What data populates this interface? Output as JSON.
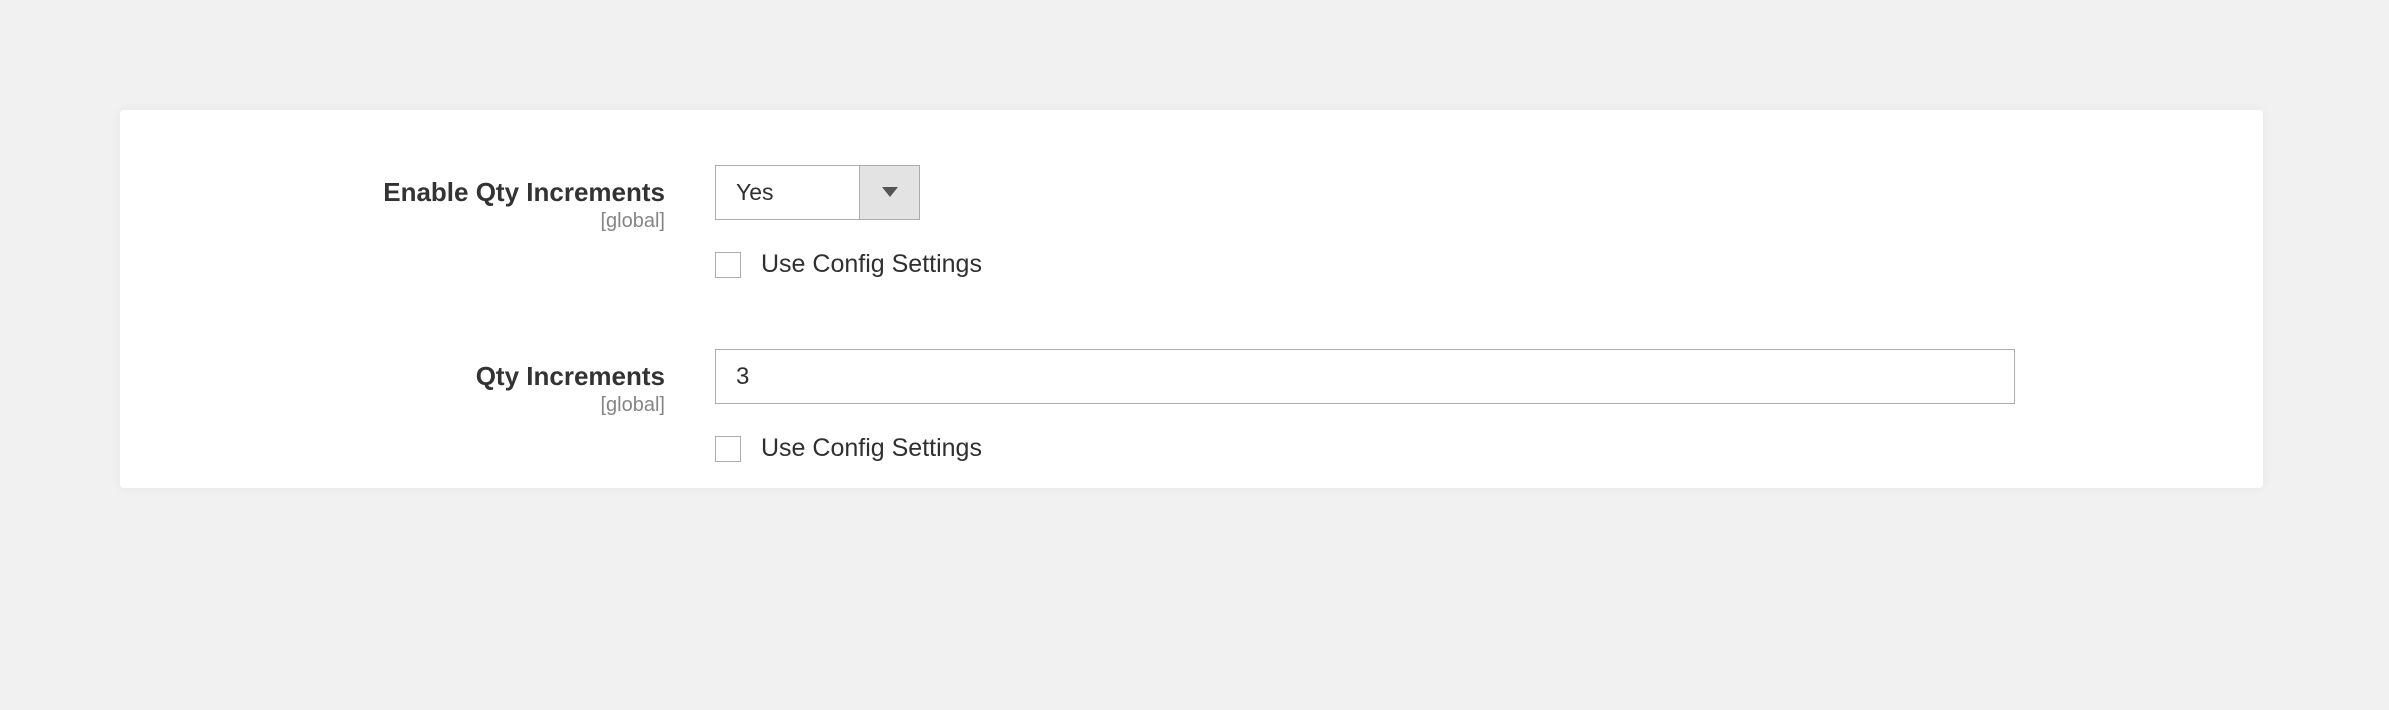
{
  "fields": {
    "enable_qty_increments": {
      "label": "Enable Qty Increments",
      "scope": "[global]",
      "value": "Yes",
      "use_config_label": "Use Config Settings"
    },
    "qty_increments": {
      "label": "Qty Increments",
      "scope": "[global]",
      "value": "3",
      "use_config_label": "Use Config Settings"
    }
  }
}
